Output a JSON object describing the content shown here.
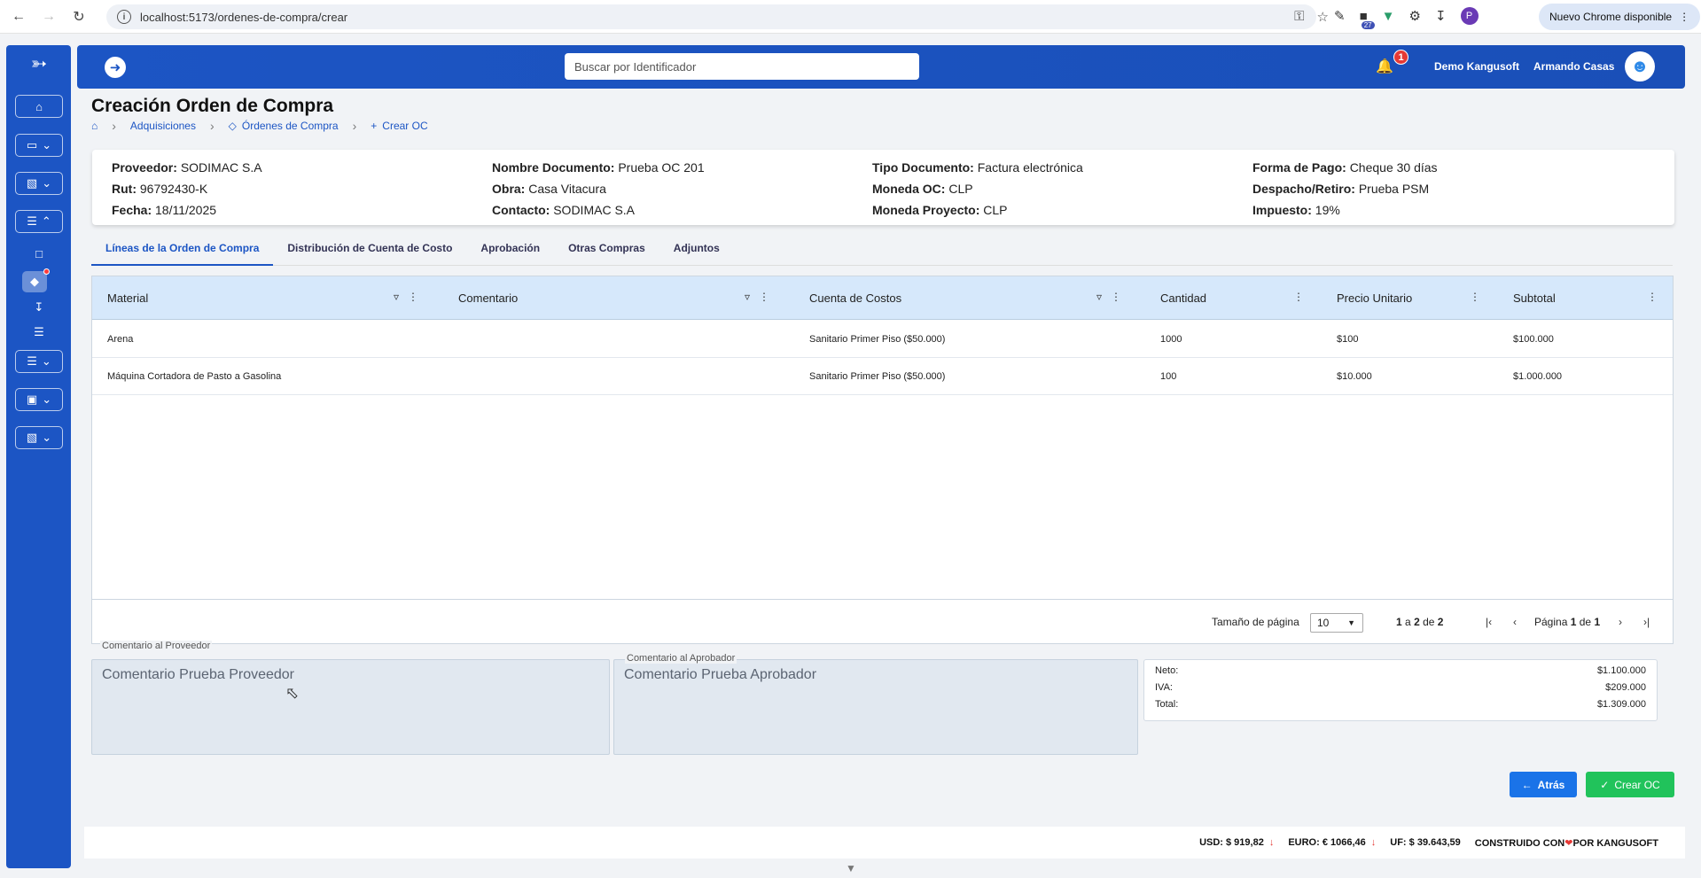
{
  "browser": {
    "url": "localhost:5173/ordenes-de-compra/crear",
    "ext_badge": "27",
    "profile_initial": "P",
    "update_label": "Nuevo Chrome disponible"
  },
  "header": {
    "search_placeholder": "Buscar por Identificador",
    "notification_count": "1",
    "company": "Demo Kangusoft",
    "user": "Armando Casas"
  },
  "page": {
    "title": "Creación Orden de Compra",
    "breadcrumb": [
      "Adquisiciones",
      "Órdenes de Compra",
      "Crear OC"
    ]
  },
  "info": {
    "proveedor_label": "Proveedor:",
    "proveedor": "SODIMAC S.A",
    "rut_label": "Rut:",
    "rut": "96792430-K",
    "fecha_label": "Fecha:",
    "fecha": "18/11/2025",
    "nombre_label": "Nombre Documento:",
    "nombre": "Prueba OC 201",
    "obra_label": "Obra:",
    "obra": "Casa Vitacura",
    "contacto_label": "Contacto:",
    "contacto": "SODIMAC S.A",
    "tipo_label": "Tipo Documento:",
    "tipo": "Factura electrónica",
    "moneda_oc_label": "Moneda OC:",
    "moneda_oc": "CLP",
    "moneda_proy_label": "Moneda Proyecto:",
    "moneda_proy": "CLP",
    "pago_label": "Forma de Pago:",
    "pago": "Cheque 30 días",
    "despacho_label": "Despacho/Retiro:",
    "despacho": "Prueba PSM",
    "impuesto_label": "Impuesto:",
    "impuesto": "19%"
  },
  "tabs": [
    "Líneas de la Orden de Compra",
    "Distribución de Cuenta de Costo",
    "Aprobación",
    "Otras Compras",
    "Adjuntos"
  ],
  "table": {
    "columns": [
      "Material",
      "Comentario",
      "Cuenta de Costos",
      "Cantidad",
      "Precio Unitario",
      "Subtotal"
    ],
    "rows": [
      [
        "Arena",
        "",
        "Sanitario Primer Piso ($50.000)",
        "1000",
        "$100",
        "$100.000"
      ],
      [
        "Máquina Cortadora de Pasto a Gasolina",
        "",
        "Sanitario Primer Piso ($50.000)",
        "100",
        "$10.000",
        "$1.000.000"
      ]
    ],
    "page_size_label": "Tamaño de página",
    "page_size": "10",
    "range_from": "1",
    "range_a": "a",
    "range_to": "2",
    "range_de": "de",
    "range_total": "2",
    "page_label": "Página",
    "page_num": "1",
    "page_de": "de",
    "page_total": "1"
  },
  "comments": {
    "proveedor_label": "Comentario al Proveedor",
    "proveedor_text": "Comentario Prueba Proveedor",
    "aprobador_label": "Comentario al Aprobador",
    "aprobador_text": "Comentario Prueba Aprobador"
  },
  "totals": {
    "neto_label": "Neto:",
    "neto": "$1.100.000",
    "iva_label": "IVA:",
    "iva": "$209.000",
    "total_label": "Total:",
    "total": "$1.309.000"
  },
  "actions": {
    "back": "Atrás",
    "create": "Crear OC"
  },
  "footer": {
    "usd": "USD: $ 919,82",
    "euro": "EURO: € 1066,46",
    "uf": "UF: $ 39.643,59",
    "built_pre": "CONSTRUIDO CON",
    "built_post": "POR KANGUSOFT"
  },
  "colors": {
    "primary": "#1c55c4",
    "success": "#21c35b",
    "danger": "#e53935",
    "table_header": "#d6e8fb"
  }
}
